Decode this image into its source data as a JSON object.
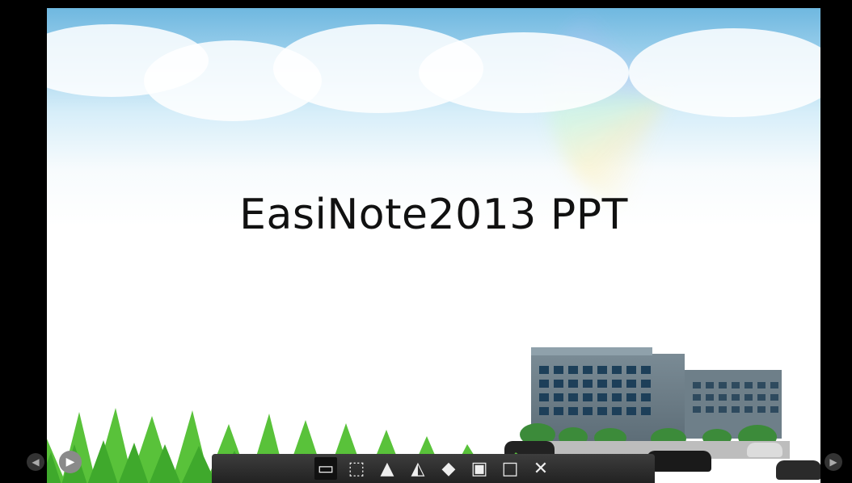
{
  "slide": {
    "title": "EasiNote2013 PPT"
  },
  "toolbar": {
    "buttons": [
      {
        "name": "presentation-icon"
      },
      {
        "name": "screen-select-icon"
      },
      {
        "name": "pen-icon"
      },
      {
        "name": "highlighter-icon"
      },
      {
        "name": "eraser-icon"
      },
      {
        "name": "save-icon"
      },
      {
        "name": "window-icon"
      },
      {
        "name": "close-icon"
      }
    ]
  },
  "colors": {
    "sky": "#6fb8e0",
    "toolbar": "#2b2b2b",
    "grass": "#58c13b"
  }
}
